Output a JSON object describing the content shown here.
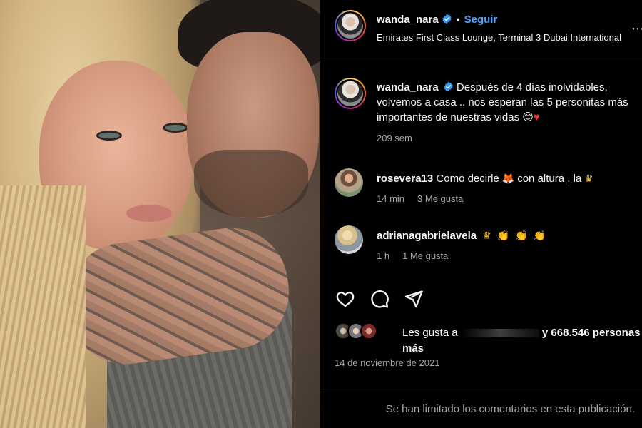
{
  "header": {
    "username": "wanda_nara",
    "separator": "•",
    "follow_label": "Seguir",
    "location": "Emirates First Class Lounge, Terminal 3 Dubai International",
    "more_icon": "more-horizontal-icon"
  },
  "caption": {
    "username": "wanda_nara",
    "text": "Después de 4 días inolvidables, volvemos a casa .. nos esperan las 5 personitas más importantes de nuestras vidas 😊",
    "emoji": "♥",
    "time": "209 sem"
  },
  "comments": [
    {
      "username": "rosevera13",
      "text_before": "Como decirle",
      "emoji_1": "🦊",
      "text_middle": "con altura , la",
      "emoji_2": "♛",
      "time": "14 min",
      "likes": "3 Me gusta"
    },
    {
      "username": "adrianagabrielavela",
      "emojis": [
        "♛",
        "👏",
        "👏",
        "👏"
      ],
      "time": "1 h",
      "likes": "1 Me gusta"
    }
  ],
  "actions": {
    "like_icon": "heart-icon",
    "comment_icon": "comment-icon",
    "share_icon": "send-icon"
  },
  "likes": {
    "prefix": "Les gusta a",
    "suffix": "y 668.546 personas más"
  },
  "date": "14 de noviembre de 2021",
  "comments_limited": "Se han limitado los comentarios en esta publicación.",
  "colors": {
    "accent": "#4fa3ff",
    "verified": "#3897f0",
    "muted": "#a8a8a8",
    "background": "#000000",
    "heart": "#ff3040"
  }
}
